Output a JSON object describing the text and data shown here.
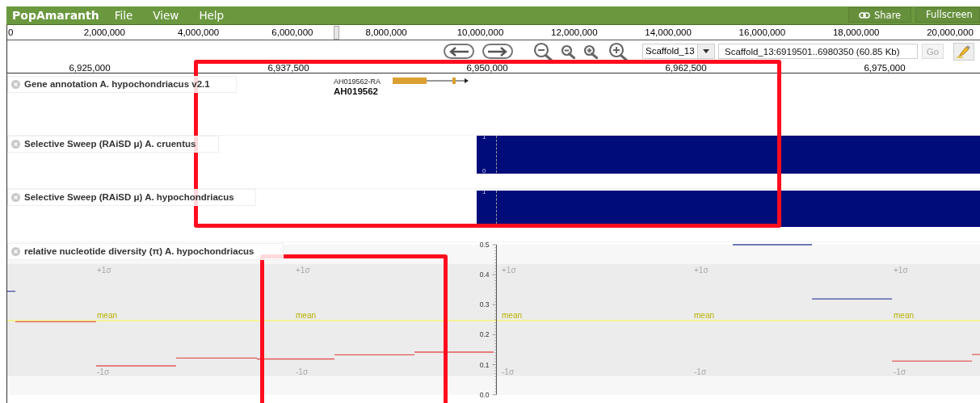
{
  "menubar": {
    "title": "PopAmaranth",
    "menus": [
      "File",
      "View",
      "Help"
    ],
    "buttons": [
      {
        "kind": "share",
        "label": "Share"
      },
      {
        "kind": "plain",
        "label": "Fullscreen"
      }
    ]
  },
  "overview_ruler": {
    "labels": [
      "0",
      "2,000,000",
      "4,000,000",
      "6,000,000",
      "8,000,000",
      "10,000,000",
      "12,000,000",
      "14,000,000",
      "16,000,000",
      "18,000,000",
      "20,000,000"
    ]
  },
  "navigation": {
    "buttons": [
      {
        "kind": "pan-left"
      },
      {
        "kind": "pan-right"
      },
      {
        "kind": "zoom-out-large"
      },
      {
        "kind": "zoom-out"
      },
      {
        "kind": "zoom-in"
      },
      {
        "kind": "zoom-in-large"
      }
    ],
    "reference": {
      "value": "Scaffold_13"
    },
    "location": {
      "value": "Scaffold_13:6919501..6980350 (60.85 Kb)"
    },
    "go": {
      "label": "Go",
      "disabled": true
    }
  },
  "detail_ruler": {
    "labels": [
      "6,925,000",
      "6,937,500",
      "6,950,000",
      "6,962,500",
      "6,975,000"
    ]
  },
  "tracks": [
    {
      "kind": "genes",
      "label": "Gene annotation A. hypochondriacus v2.1",
      "features": [
        {
          "name": "AH019562-RA",
          "label": "AH019562"
        }
      ]
    },
    {
      "kind": "sweep",
      "label": "Selective Sweep (RAiSD μ) A. cruentus",
      "axis": [
        "1",
        "0"
      ]
    },
    {
      "kind": "sweep",
      "label": "Selective Sweep (RAiSD μ) A. hypochondriacus",
      "axis": [
        "1"
      ]
    },
    {
      "kind": "diversity",
      "label": "relative nucleotide diversity (π) A. hypochondriacus",
      "y_axis": [
        "0.5",
        "0.4",
        "0.3",
        "0.2",
        "0.1",
        "0.0"
      ],
      "band_labels": [
        {
          "kind": "upper",
          "labels": [
            "+1σ",
            "+1σ",
            "+1σ",
            "+1σ",
            "+1σ"
          ]
        },
        {
          "kind": "mean",
          "labels": [
            "mean",
            "mean",
            "mean",
            "mean",
            "mean"
          ]
        },
        {
          "kind": "lower",
          "labels": [
            "-1σ",
            "-1σ",
            "-1σ",
            "-1σ",
            "-1σ"
          ]
        }
      ]
    }
  ],
  "markup": [
    {
      "kind": "rectangle"
    },
    {
      "kind": "rectangle"
    }
  ]
}
